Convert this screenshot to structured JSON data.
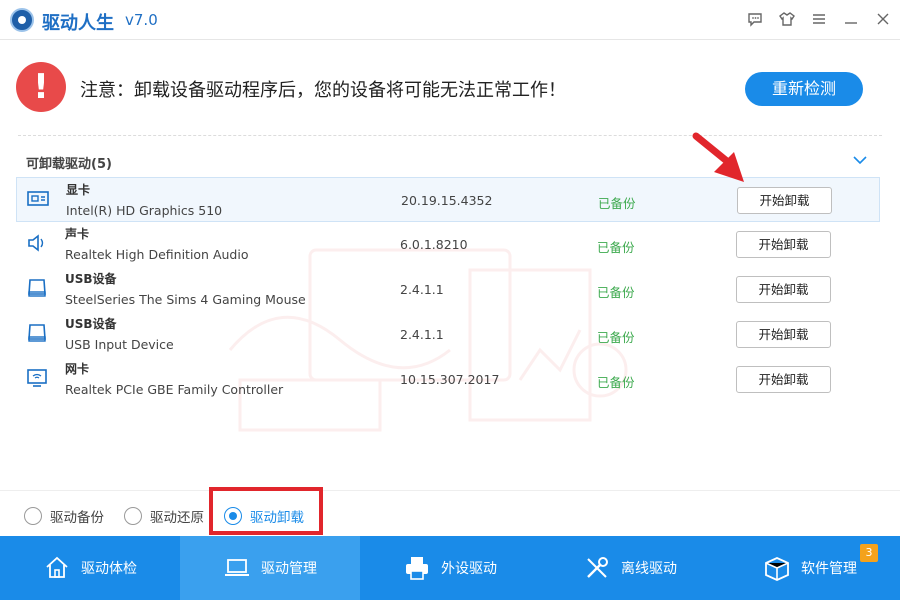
{
  "app": {
    "title": "驱动人生",
    "version": "v7.0"
  },
  "notice": {
    "text": "注意：卸载设备驱动程序后，您的设备将可能无法正常工作！",
    "recheck_label": "重新检测"
  },
  "section": {
    "title": "可卸载驱动(5)"
  },
  "drivers": [
    {
      "category": "显卡",
      "name": "Intel(R) HD Graphics 510",
      "version": "20.19.15.4352",
      "status": "已备份",
      "action": "开始卸载",
      "icon": "gpu-icon"
    },
    {
      "category": "声卡",
      "name": "Realtek High Definition Audio",
      "version": "6.0.1.8210",
      "status": "已备份",
      "action": "开始卸载",
      "icon": "speaker-icon"
    },
    {
      "category": "USB设备",
      "name": "SteelSeries The Sims 4 Gaming Mouse",
      "version": "2.4.1.1",
      "status": "已备份",
      "action": "开始卸载",
      "icon": "usb-device-icon"
    },
    {
      "category": "USB设备",
      "name": "USB Input Device",
      "version": "2.4.1.1",
      "status": "已备份",
      "action": "开始卸载",
      "icon": "usb-device-icon"
    },
    {
      "category": "网卡",
      "name": "Realtek PCIe GBE Family Controller",
      "version": "10.15.307.2017",
      "status": "已备份",
      "action": "开始卸载",
      "icon": "network-card-icon"
    }
  ],
  "modes": [
    {
      "label": "驱动备份",
      "checked": false
    },
    {
      "label": "驱动还原",
      "checked": false
    },
    {
      "label": "驱动卸载",
      "checked": true
    }
  ],
  "nav": [
    {
      "label": "驱动体检",
      "icon": "home-icon"
    },
    {
      "label": "驱动管理",
      "icon": "laptop-icon",
      "active": true
    },
    {
      "label": "外设驱动",
      "icon": "printer-icon"
    },
    {
      "label": "离线驱动",
      "icon": "tools-icon"
    },
    {
      "label": "软件管理",
      "icon": "box-icon",
      "badge": "3"
    }
  ],
  "colors": {
    "primary": "#1a8be8",
    "warning": "#e84a4a",
    "success": "#3eaa4f",
    "annotation": "#e1262c",
    "badge": "#f4a21c"
  }
}
